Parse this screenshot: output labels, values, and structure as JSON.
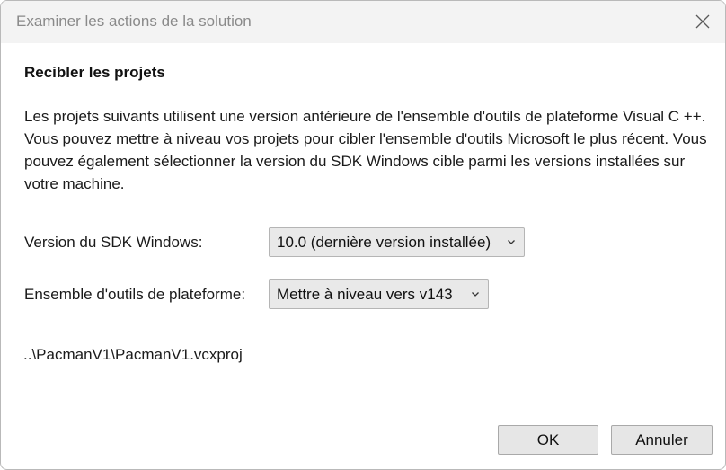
{
  "window": {
    "title": "Examiner les actions de la solution",
    "close_icon": "close-icon"
  },
  "main": {
    "heading": "Recibler les projets",
    "description": "Les projets suivants utilisent une version antérieure de l'ensemble d'outils de plateforme Visual C ++. Vous pouvez mettre à niveau vos projets pour cibler l'ensemble d'outils Microsoft le plus récent. Vous pouvez également sélectionner la version du SDK Windows cible parmi les versions installées sur votre machine.",
    "sdk": {
      "label": "Version du SDK Windows:",
      "selected": "10.0 (dernière version installée)",
      "icon": "chevron-down-icon"
    },
    "toolset": {
      "label": "Ensemble d'outils de plateforme:",
      "selected": "Mettre à niveau vers v143",
      "icon": "chevron-down-icon"
    },
    "project_path": "..\\PacmanV1\\PacmanV1.vcxproj"
  },
  "buttons": {
    "ok": "OK",
    "cancel": "Annuler"
  }
}
